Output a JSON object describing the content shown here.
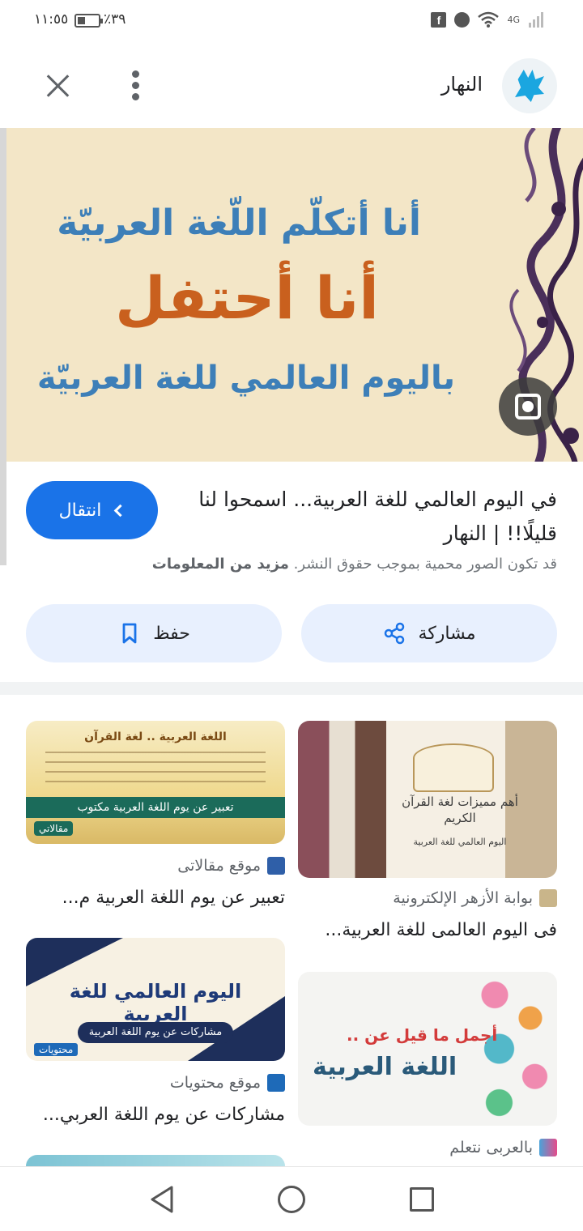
{
  "status_bar": {
    "time": "١١:٥٥",
    "battery_pct": "٪٣٩",
    "network": "4G",
    "icons": [
      "facebook-icon",
      "ball-icon",
      "wifi-icon",
      "signal-icon"
    ]
  },
  "header": {
    "source_name": "النهار",
    "close_icon": "close-icon",
    "menu_icon": "more-vert-icon"
  },
  "hero": {
    "line1": "أنا أتكلّم اللّغة العربيّة",
    "line2": "أنا أحتفل",
    "line3": "باليوم العالمي للغة العربيّة",
    "lens_icon": "google-lens-icon"
  },
  "details": {
    "title": "في اليوم العالمي للغة العربية... اسمحوا لنا قليلًا!! | النهار",
    "visit_label": "انتقال",
    "copyright": "قد تكون الصور محمية بموجب حقوق النشر.",
    "more_info": "مزيد من المعلومات",
    "share_label": "مشاركة",
    "save_label": "حفظ"
  },
  "related": [
    {
      "source": "بوابة الأزهر الإلكترونية",
      "title": "فى اليوم العالمى للغة العربية...",
      "img_title": "أهم مميزات لغة القرآن الكريم",
      "img_sub": "اليوم العالمي للغة العربية"
    },
    {
      "source": "موقع مقالاتى",
      "title": "تعبير عن يوم اللغة العربية م...",
      "img_head": "اللغة العربية .. لغة القرآن",
      "img_band": "تعبير عن يوم اللغة العربية مكتوب",
      "img_tag": "مقالاتي"
    },
    {
      "source": "بالعربى نتعلم",
      "title": "",
      "img_t1": "أجمل ما قيل عن ..",
      "img_t2": "اللغة العربية"
    },
    {
      "source": "موقع محتويات",
      "title": "مشاركات عن يوم اللغة العربي...",
      "img_cal": "اليوم العالمي للغة العربية",
      "img_pill": "مشاركات عن يوم اللغة العربية",
      "img_tag": "محتويات"
    }
  ],
  "nav": {
    "back_icon": "back-triangle-icon",
    "home_icon": "home-circle-icon",
    "recent_icon": "recent-square-icon"
  },
  "colors": {
    "accent": "#1a73e8",
    "button_bg": "#e8f0fe",
    "hero_bg": "#f3e6c7",
    "hero_blue": "#3d7fb8",
    "hero_orange": "#c9601e"
  }
}
